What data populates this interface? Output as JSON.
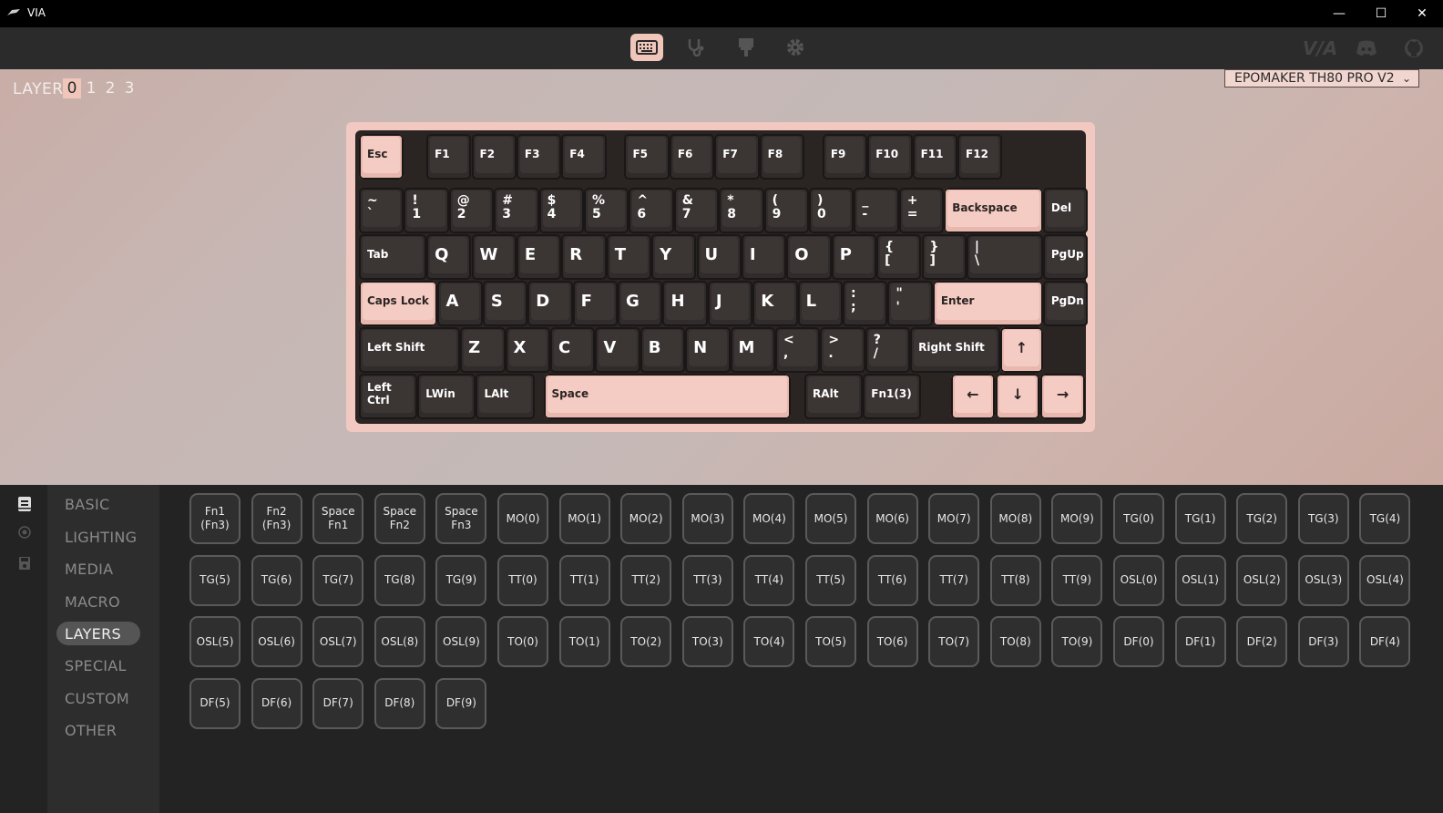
{
  "app": {
    "title": "VIA",
    "minimize": "—",
    "maximize": "☐",
    "close": "✕"
  },
  "toolbar": {
    "icons": [
      "keyboard-icon",
      "stethoscope-icon",
      "paintbrush-icon",
      "gear-icon"
    ],
    "external": {
      "via_logo": "V/A",
      "discord": "discord-icon",
      "github": "github-icon"
    }
  },
  "config": {
    "layer_label": "LAYER",
    "layers": [
      "0",
      "1",
      "2",
      "3"
    ],
    "active_layer": "0",
    "device": "EPOMAKER TH80 PRO V2",
    "device_chevron": "⌄"
  },
  "keyboard": {
    "row0": [
      "Esc",
      "F1",
      "F2",
      "F3",
      "F4",
      "F5",
      "F6",
      "F7",
      "F8",
      "F9",
      "F10",
      "F11",
      "F12"
    ],
    "row1": [
      [
        "~",
        "`"
      ],
      [
        "!",
        "1"
      ],
      [
        "@",
        "2"
      ],
      [
        "#",
        "3"
      ],
      [
        "$",
        "4"
      ],
      [
        "%",
        "5"
      ],
      [
        "^",
        "6"
      ],
      [
        "&",
        "7"
      ],
      [
        "*",
        "8"
      ],
      [
        "(",
        "9"
      ],
      [
        ")",
        "0"
      ],
      [
        "_",
        "-"
      ],
      [
        "+",
        "="
      ],
      "Backspace",
      "Del"
    ],
    "row2": [
      "Tab",
      "Q",
      "W",
      "E",
      "R",
      "T",
      "Y",
      "U",
      "I",
      "O",
      "P",
      [
        "{",
        "["
      ],
      [
        "}",
        "]"
      ],
      [
        "|",
        "\\"
      ],
      "PgUp"
    ],
    "row3": [
      "Caps Lock",
      "A",
      "S",
      "D",
      "F",
      "G",
      "H",
      "J",
      "K",
      "L",
      [
        ":",
        ";"
      ],
      [
        "\"",
        "'"
      ],
      "Enter",
      "PgDn"
    ],
    "row4": [
      "Left Shift",
      "Z",
      "X",
      "C",
      "V",
      "B",
      "N",
      "M",
      [
        "<",
        ","
      ],
      [
        ">",
        "."
      ],
      [
        "?",
        "/"
      ],
      "Right Shift",
      "↑"
    ],
    "row5": [
      "Left Ctrl",
      "LWin",
      "LAlt",
      "Space",
      "RAlt",
      "Fn1(3)",
      "←",
      "↓",
      "→"
    ]
  },
  "menu": {
    "items": [
      "BASIC",
      "LIGHTING",
      "MEDIA",
      "MACRO",
      "LAYERS",
      "SPECIAL",
      "CUSTOM",
      "OTHER"
    ],
    "active": "LAYERS",
    "side_icons": [
      "document-icon",
      "circle-target-icon",
      "save-icon"
    ]
  },
  "keycodes": [
    "Fn1\n(Fn3)",
    "Fn2\n(Fn3)",
    "Space\nFn1",
    "Space\nFn2",
    "Space\nFn3",
    "MO(0)",
    "MO(1)",
    "MO(2)",
    "MO(3)",
    "MO(4)",
    "MO(5)",
    "MO(6)",
    "MO(7)",
    "MO(8)",
    "MO(9)",
    "TG(0)",
    "TG(1)",
    "TG(2)",
    "TG(3)",
    "TG(4)",
    "TG(5)",
    "TG(6)",
    "TG(7)",
    "TG(8)",
    "TG(9)",
    "TT(0)",
    "TT(1)",
    "TT(2)",
    "TT(3)",
    "TT(4)",
    "TT(5)",
    "TT(6)",
    "TT(7)",
    "TT(8)",
    "TT(9)",
    "OSL(0)",
    "OSL(1)",
    "OSL(2)",
    "OSL(3)",
    "OSL(4)",
    "OSL(5)",
    "OSL(6)",
    "OSL(7)",
    "OSL(8)",
    "OSL(9)",
    "TO(0)",
    "TO(1)",
    "TO(2)",
    "TO(3)",
    "TO(4)",
    "TO(5)",
    "TO(6)",
    "TO(7)",
    "TO(8)",
    "TO(9)",
    "DF(0)",
    "DF(1)",
    "DF(2)",
    "DF(3)",
    "DF(4)",
    "DF(5)",
    "DF(6)",
    "DF(7)",
    "DF(8)",
    "DF(9)"
  ],
  "colors": {
    "accent": "#f0c6bb",
    "key_dark": "#302c2b",
    "key_light": "#f4ccc3"
  }
}
